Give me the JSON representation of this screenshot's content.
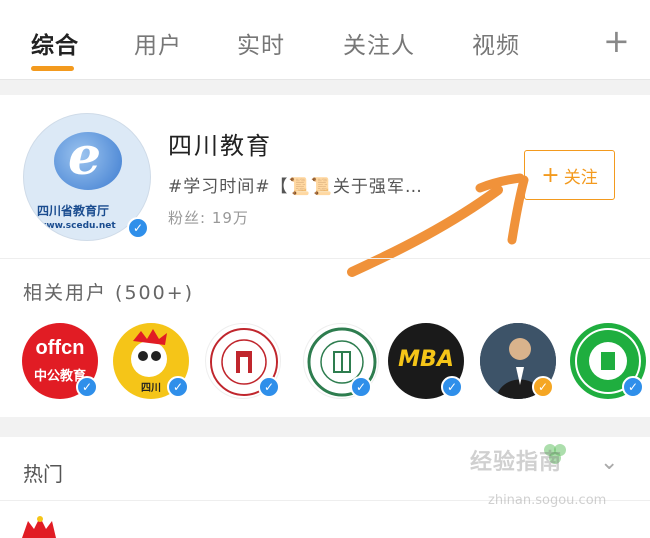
{
  "tabs": {
    "items": [
      {
        "label": "综合"
      },
      {
        "label": "用户"
      },
      {
        "label": "实时"
      },
      {
        "label": "关注人"
      },
      {
        "label": "视频"
      }
    ],
    "add_label": "+"
  },
  "account": {
    "name": "四川教育",
    "description": "#学习时间#【📜📜关于强军…",
    "fans_label": "粉丝:",
    "fans_count": "19万",
    "avatar_org": "四川省教育厅",
    "avatar_site": "www.scedu.net",
    "follow_label": "关注",
    "follow_plus": "+"
  },
  "related": {
    "title": "相关用户 (500+)",
    "users": [
      {
        "name": "offcn-avatar",
        "label_top": "offcn",
        "label_bottom": "中公教育",
        "bg": "#e11c24",
        "verified": "blue"
      },
      {
        "name": "sichuan-mascot-avatar",
        "label_bottom": "四川",
        "bg": "#f5c518",
        "verified": "blue"
      },
      {
        "name": "university-seal-avatar",
        "bg": "#ffffff",
        "verified": "blue"
      },
      {
        "name": "school-green-avatar",
        "bg": "#ffffff",
        "verified": "blue"
      },
      {
        "name": "mba-avatar",
        "label_top": "MBA",
        "bg": "#1a1a1a",
        "verified": "blue"
      },
      {
        "name": "person-avatar",
        "bg": "#2c3e50",
        "verified": "gold"
      },
      {
        "name": "green-school-avatar",
        "bg": "#1fae3f",
        "verified": "blue"
      }
    ]
  },
  "hot": {
    "title": "热门"
  },
  "watermark": {
    "text": "经验指南",
    "sub": "zhinan.sogou.com"
  },
  "colors": {
    "accent": "#f39a1e",
    "verified": "#2f8fea",
    "gold": "#f5a623"
  }
}
